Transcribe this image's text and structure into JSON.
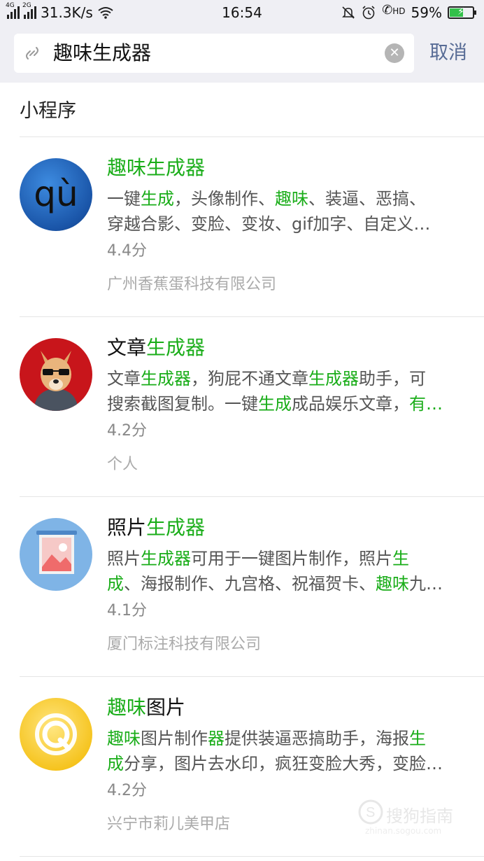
{
  "status_bar": {
    "net1": "4G",
    "net2": "2G",
    "speed": "31.3K/s",
    "time": "16:54",
    "hd": "HD",
    "battery": "59%",
    "battery_level": 0.59
  },
  "search": {
    "query": "趣味生成器",
    "cancel_label": "取消"
  },
  "section_title": "小程序",
  "results": [
    {
      "name": [
        {
          "t": "趣味生成器",
          "hl": true
        }
      ],
      "desc_lines": [
        [
          {
            "t": "一键",
            "hl": false
          },
          {
            "t": "生成",
            "hl": true
          },
          {
            "t": "，头像制作、",
            "hl": false
          },
          {
            "t": "趣味",
            "hl": true
          },
          {
            "t": "、装逼、恶搞、",
            "hl": false
          }
        ],
        [
          {
            "t": "穿越合影、变脸、变妆、gif加字、自定义…",
            "hl": false
          }
        ]
      ],
      "score": "4.4分",
      "company": "广州香蕉蛋科技有限公司",
      "avatar_text": "qù"
    },
    {
      "name": [
        {
          "t": "文章",
          "hl": false
        },
        {
          "t": "生成器",
          "hl": true
        }
      ],
      "desc_lines": [
        [
          {
            "t": "文章",
            "hl": false
          },
          {
            "t": "生成器",
            "hl": true
          },
          {
            "t": "，狗屁不通文章",
            "hl": false
          },
          {
            "t": "生成器",
            "hl": true
          },
          {
            "t": "助手，可",
            "hl": false
          }
        ],
        [
          {
            "t": "搜索截图复制。一键",
            "hl": false
          },
          {
            "t": "生成",
            "hl": true
          },
          {
            "t": "成品娱乐文章，",
            "hl": false
          },
          {
            "t": "有…",
            "hl": true
          }
        ]
      ],
      "score": "4.2分",
      "company": "个人",
      "avatar_text": ""
    },
    {
      "name": [
        {
          "t": "照片",
          "hl": false
        },
        {
          "t": "生成器",
          "hl": true
        }
      ],
      "desc_lines": [
        [
          {
            "t": "照片",
            "hl": false
          },
          {
            "t": "生成器",
            "hl": true
          },
          {
            "t": "可用于一键图片制作，照片",
            "hl": false
          },
          {
            "t": "生",
            "hl": true
          }
        ],
        [
          {
            "t": "成",
            "hl": true
          },
          {
            "t": "、海报制作、九宫格、祝福贺卡、",
            "hl": false
          },
          {
            "t": "趣味",
            "hl": true
          },
          {
            "t": "九…",
            "hl": false
          }
        ]
      ],
      "score": "4.1分",
      "company": "厦门标注科技有限公司",
      "avatar_text": ""
    },
    {
      "name": [
        {
          "t": "趣味",
          "hl": true
        },
        {
          "t": "图片",
          "hl": false
        }
      ],
      "desc_lines": [
        [
          {
            "t": "趣味",
            "hl": true
          },
          {
            "t": "图片制作",
            "hl": false
          },
          {
            "t": "器",
            "hl": true
          },
          {
            "t": "提供装逼恶搞助手，海报",
            "hl": false
          },
          {
            "t": "生",
            "hl": true
          }
        ],
        [
          {
            "t": "成",
            "hl": true
          },
          {
            "t": "分享，图片去水印，疯狂变脸大秀，变脸…",
            "hl": false
          }
        ]
      ],
      "score": "4.2分",
      "company": "兴宁市莉儿美甲店",
      "avatar_text": ""
    }
  ],
  "watermark": {
    "text": "搜狗指南",
    "sub": "zhinan.sogou.com"
  },
  "colors": {
    "highlight": "#1aad19",
    "link_blue": "#576b95",
    "topbar_bg": "#efeff4"
  }
}
